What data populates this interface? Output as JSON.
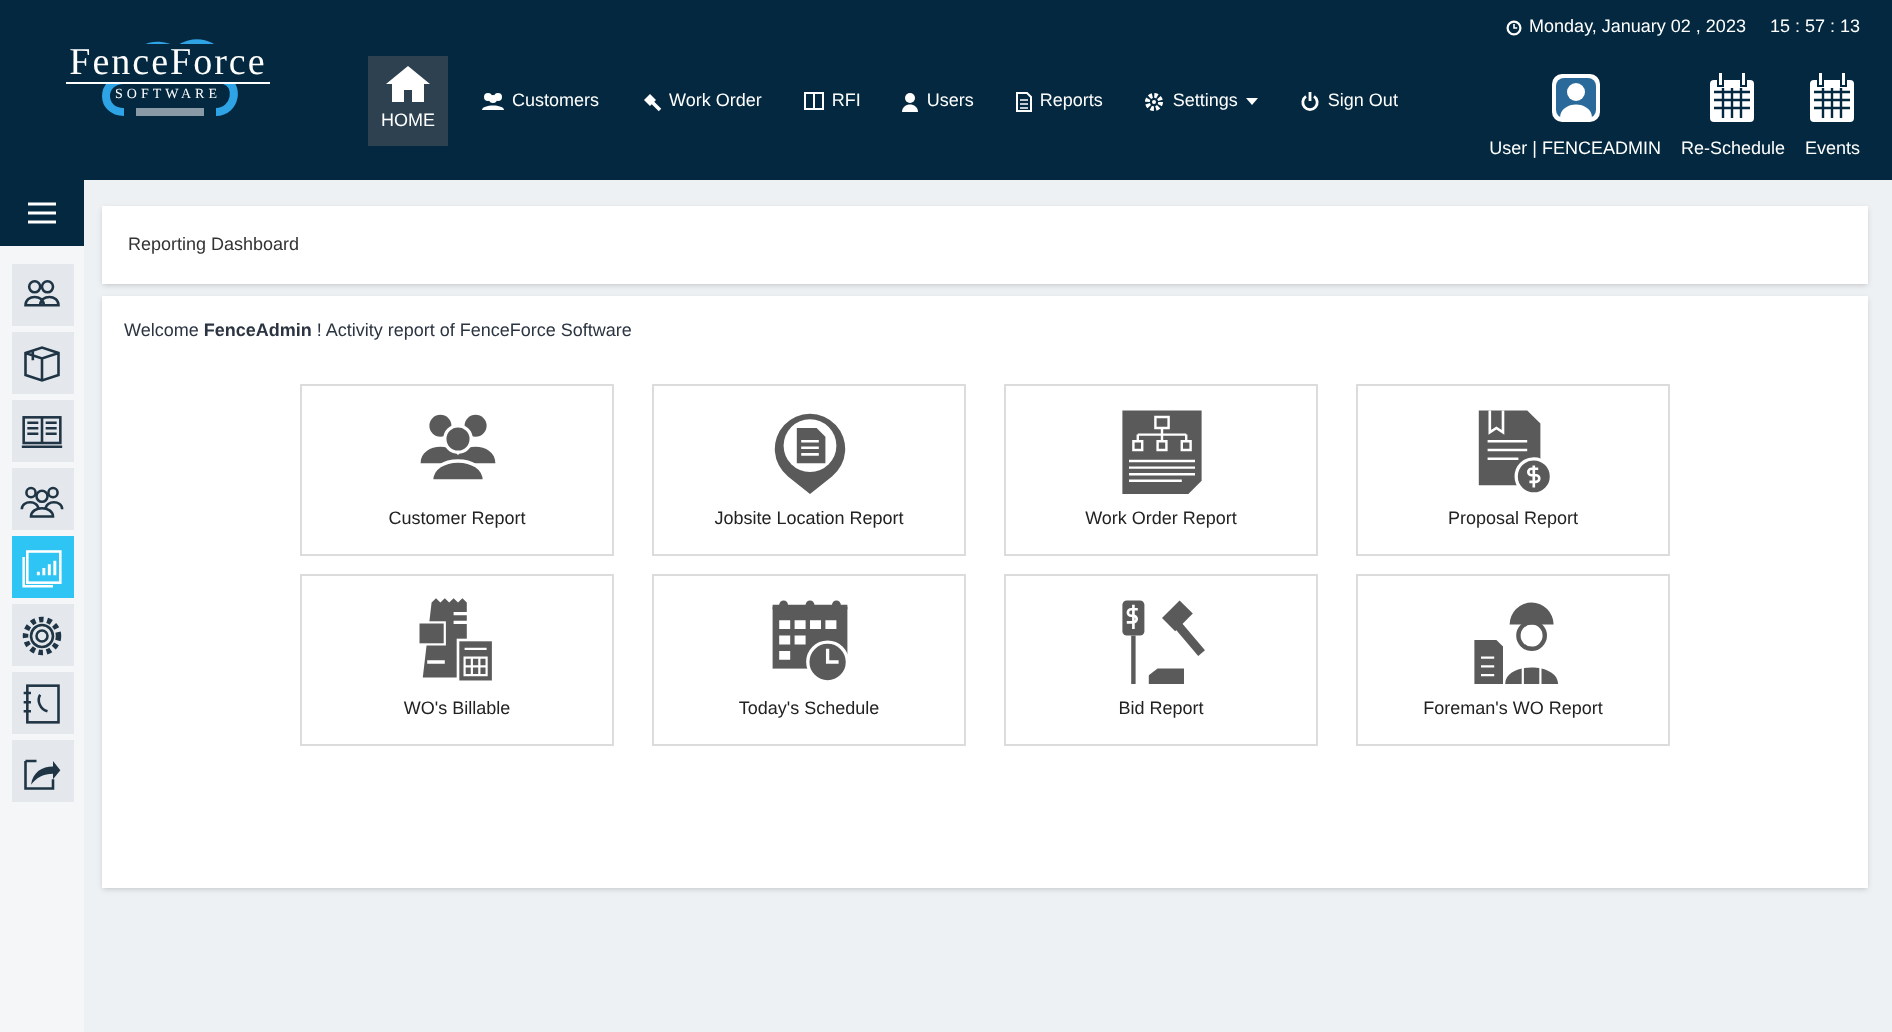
{
  "logo": {
    "name": "FenceForce",
    "tagline": "SOFTWARE"
  },
  "nav": [
    {
      "label": "HOME",
      "selected": true
    },
    {
      "label": "Customers",
      "selected": false
    },
    {
      "label": "Work Order",
      "selected": false
    },
    {
      "label": "RFI",
      "selected": false
    },
    {
      "label": "Users",
      "selected": false
    },
    {
      "label": "Reports",
      "selected": false
    },
    {
      "label": "Settings",
      "selected": false,
      "dropdown": true
    },
    {
      "label": "Sign Out",
      "selected": false
    }
  ],
  "clock": {
    "date": "Monday, January 02 , 2023",
    "time": "15 : 57 : 13"
  },
  "header_actions": [
    {
      "label": "User | FENCEADMIN"
    },
    {
      "label": "Re-Schedule"
    },
    {
      "label": "Events"
    }
  ],
  "sidebar": {
    "items": [
      {
        "selected": false
      },
      {
        "selected": false
      },
      {
        "selected": false
      },
      {
        "selected": false
      },
      {
        "selected": true
      },
      {
        "selected": false
      },
      {
        "selected": false
      },
      {
        "selected": false
      }
    ]
  },
  "page_title": "Reporting Dashboard",
  "welcome": "Welcome **FenceAdmin** ! Activity report of FenceForce Software",
  "reports": [
    {
      "label": "Customer Report"
    },
    {
      "label": "Jobsite Location Report"
    },
    {
      "label": "Work Order Report"
    },
    {
      "label": "Proposal Report"
    },
    {
      "label": "WO's Billable"
    },
    {
      "label": "Today's Schedule"
    },
    {
      "label": "Bid Report"
    },
    {
      "label": "Foreman's WO Report"
    }
  ]
}
